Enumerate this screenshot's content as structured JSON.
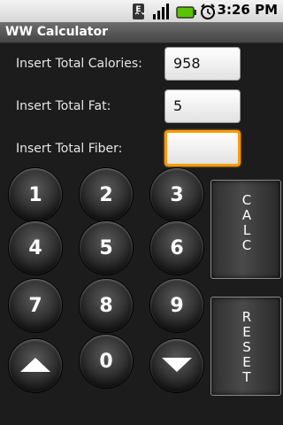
{
  "status_bar": {
    "time": "3:26 PM",
    "icons": [
      "data-transfer-icon",
      "signal-icon",
      "battery-icon",
      "alarm-icon"
    ]
  },
  "app": {
    "title": "WW Calculator"
  },
  "form": {
    "calories": {
      "label": "Insert Total Calories:",
      "value": "958"
    },
    "fat": {
      "label": "Insert Total Fat:",
      "value": "5"
    },
    "fiber": {
      "label": "Insert Total Fiber:",
      "value": ""
    }
  },
  "keypad": {
    "k1": "1",
    "k2": "2",
    "k3": "3",
    "k4": "4",
    "k5": "5",
    "k6": "6",
    "k7": "7",
    "k8": "8",
    "k9": "9",
    "k0": "0",
    "up": "up-arrow-icon",
    "down": "down-arrow-icon"
  },
  "actions": {
    "calc": "CALC",
    "reset": "RESET"
  },
  "colors": {
    "focus": "#ff9a00",
    "battery": "#59c400"
  }
}
